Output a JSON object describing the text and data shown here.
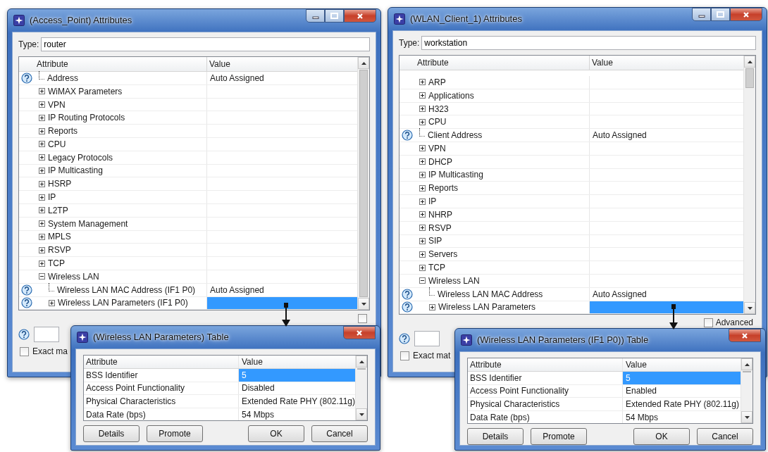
{
  "windows": [
    {
      "title": "(Access_Point) Attributes",
      "type_label": "Type:",
      "type_value": "router",
      "columns": [
        "Attribute",
        "Value"
      ],
      "rows": [
        {
          "kind": "attribute",
          "label": "Address",
          "value": "Auto Assigned",
          "selected": false
        },
        {
          "kind": "group",
          "label": "WiMAX Parameters",
          "expanded": false,
          "selected": false
        },
        {
          "kind": "group",
          "label": "VPN",
          "expanded": false,
          "selected": false
        },
        {
          "kind": "group",
          "label": "IP Routing Protocols",
          "expanded": false,
          "selected": false
        },
        {
          "kind": "group",
          "label": "Reports",
          "expanded": false,
          "selected": false
        },
        {
          "kind": "group",
          "label": "CPU",
          "expanded": false,
          "selected": false
        },
        {
          "kind": "group",
          "label": "Legacy Protocols",
          "expanded": false,
          "selected": false
        },
        {
          "kind": "group",
          "label": "IP Multicasting",
          "expanded": false,
          "selected": false
        },
        {
          "kind": "group",
          "label": "HSRP",
          "expanded": false,
          "selected": false
        },
        {
          "kind": "group",
          "label": "IP",
          "expanded": false,
          "selected": false
        },
        {
          "kind": "group",
          "label": "L2TP",
          "expanded": false,
          "selected": false
        },
        {
          "kind": "group",
          "label": "System Management",
          "expanded": false,
          "selected": false
        },
        {
          "kind": "group",
          "label": "MPLS",
          "expanded": false,
          "selected": false
        },
        {
          "kind": "group",
          "label": "RSVP",
          "expanded": false,
          "selected": false
        },
        {
          "kind": "group",
          "label": "TCP",
          "expanded": false,
          "selected": false
        },
        {
          "kind": "group",
          "label": "Wireless LAN",
          "expanded": true,
          "selected": false,
          "children": [
            {
              "kind": "attribute",
              "label": "Wireless LAN MAC Address (IF1 P0)",
              "value": "Auto Assigned",
              "selected": false
            },
            {
              "kind": "compound",
              "label": "Wireless LAN Parameters (IF1 P0)",
              "expanded": false,
              "selected": true
            }
          ]
        }
      ],
      "advanced": {
        "checked": false
      },
      "exact_match": {
        "label": "Exact ma",
        "checked": false
      }
    },
    {
      "title": "(WLAN_Client_1) Attributes",
      "type_label": "Type:",
      "type_value": "workstation",
      "columns": [
        "Attribute",
        "Value"
      ],
      "rows": [
        {
          "kind": "group",
          "label": "ARP",
          "expanded": false,
          "selected": false
        },
        {
          "kind": "group",
          "label": "Applications",
          "expanded": false,
          "selected": false
        },
        {
          "kind": "group",
          "label": "H323",
          "expanded": false,
          "selected": false
        },
        {
          "kind": "group",
          "label": "CPU",
          "expanded": false,
          "selected": false
        },
        {
          "kind": "attribute",
          "label": "Client Address",
          "value": "Auto Assigned",
          "selected": false
        },
        {
          "kind": "group",
          "label": "VPN",
          "expanded": false,
          "selected": false
        },
        {
          "kind": "group",
          "label": "DHCP",
          "expanded": false,
          "selected": false
        },
        {
          "kind": "group",
          "label": "IP Multicasting",
          "expanded": false,
          "selected": false
        },
        {
          "kind": "group",
          "label": "Reports",
          "expanded": false,
          "selected": false
        },
        {
          "kind": "group",
          "label": "IP",
          "expanded": false,
          "selected": false
        },
        {
          "kind": "group",
          "label": "NHRP",
          "expanded": false,
          "selected": false
        },
        {
          "kind": "group",
          "label": "RSVP",
          "expanded": false,
          "selected": false
        },
        {
          "kind": "group",
          "label": "SIP",
          "expanded": false,
          "selected": false
        },
        {
          "kind": "group",
          "label": "Servers",
          "expanded": false,
          "selected": false
        },
        {
          "kind": "group",
          "label": "TCP",
          "expanded": false,
          "selected": false
        },
        {
          "kind": "group",
          "label": "Wireless LAN",
          "expanded": true,
          "selected": false,
          "children": [
            {
              "kind": "attribute",
              "label": "Wireless LAN MAC Address",
              "value": "Auto Assigned",
              "selected": false
            },
            {
              "kind": "compound",
              "label": "Wireless LAN Parameters",
              "expanded": false,
              "selected": true
            }
          ]
        }
      ],
      "advanced": {
        "label": "Advanced",
        "checked": false
      },
      "exact_match": {
        "label": "Exact mat",
        "checked": false
      }
    }
  ],
  "tables": [
    {
      "title": "(Wireless LAN Parameters) Table",
      "columns": [
        "Attribute",
        "Value"
      ],
      "rows": [
        {
          "attribute": "BSS Identifier",
          "value": "5",
          "selected": true
        },
        {
          "attribute": "Access Point Functionality",
          "value": "Disabled",
          "selected": false
        },
        {
          "attribute": "Physical Characteristics",
          "value": "Extended Rate PHY (802.11g)",
          "selected": false
        },
        {
          "attribute": "Data Rate (bps)",
          "value": "54 Mbps",
          "selected": false
        }
      ],
      "buttons": [
        "Details",
        "Promote",
        "OK",
        "Cancel"
      ]
    },
    {
      "title": "(Wireless LAN Parameters (IF1 P0)) Table",
      "columns": [
        "Attribute",
        "Value"
      ],
      "rows": [
        {
          "attribute": "BSS Identifier",
          "value": "5",
          "selected": true
        },
        {
          "attribute": "Access Point Functionality",
          "value": "Enabled",
          "selected": false
        },
        {
          "attribute": "Physical Characteristics",
          "value": "Extended Rate PHY (802.11g)",
          "selected": false
        },
        {
          "attribute": "Data Rate (bps)",
          "value": "54 Mbps",
          "selected": false
        }
      ],
      "buttons": [
        "Details",
        "Promote",
        "OK",
        "Cancel"
      ]
    }
  ]
}
